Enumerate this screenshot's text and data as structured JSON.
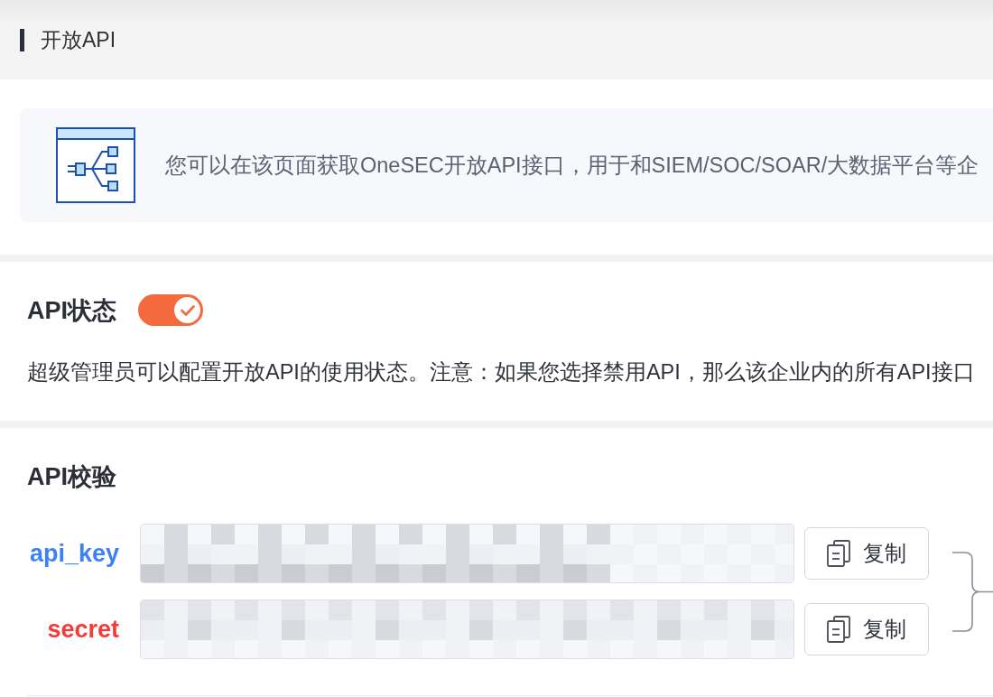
{
  "page_header": {
    "title": "开放API"
  },
  "intro_banner": {
    "text": "您可以在该页面获取OneSEC开放API接口，用于和SIEM/SOC/SOAR/大数据平台等企"
  },
  "api_status": {
    "title": "API状态",
    "toggle": {
      "on": true
    },
    "description": "超级管理员可以配置开放API的使用状态。注意：如果您选择禁用API，那么该企业内的所有API接口"
  },
  "api_verification": {
    "title": "API校验",
    "credentials": [
      {
        "label": "api_key",
        "color": "#3d82f4",
        "copy_button": "复制"
      },
      {
        "label": "secret",
        "color": "#f23b3b",
        "copy_button": "复制"
      }
    ]
  }
}
